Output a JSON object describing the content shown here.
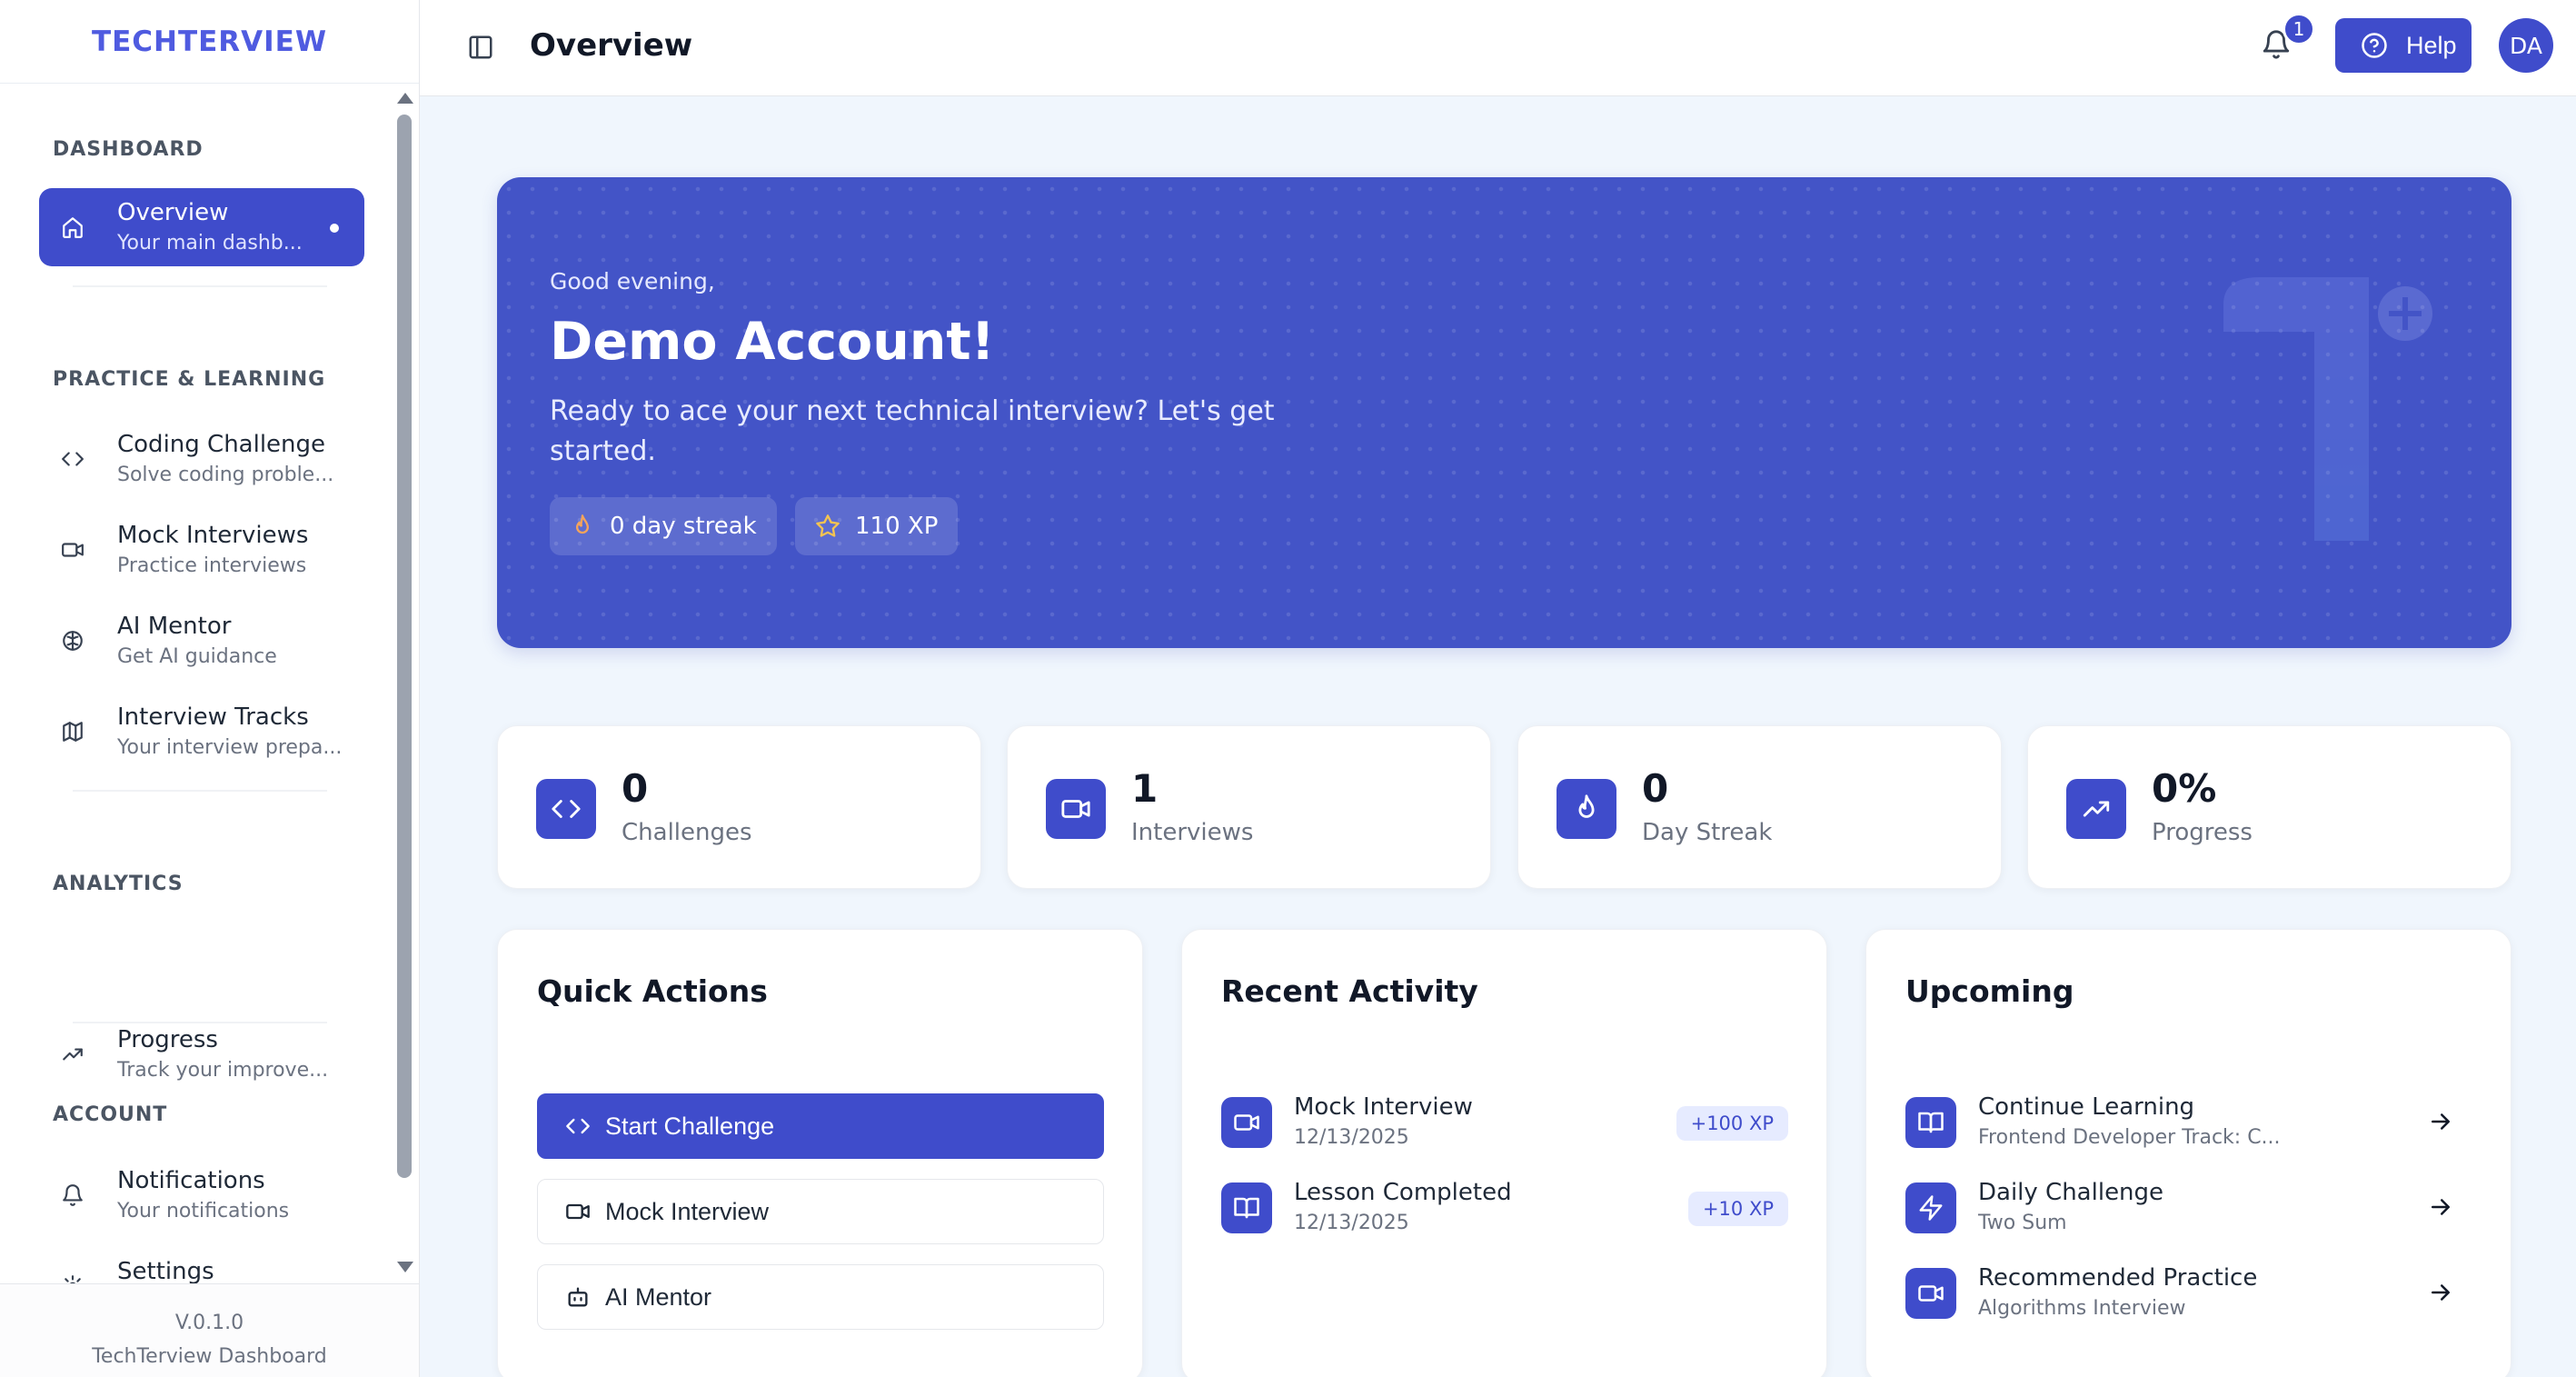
{
  "app": {
    "logo": "TECHTERVIEW",
    "version": "V.0.1.0",
    "footer_name": "TechTerview Dashboard"
  },
  "sidebar": {
    "sections": [
      {
        "label": "DASHBOARD"
      },
      {
        "label": "PRACTICE & LEARNING"
      },
      {
        "label": "ANALYTICS"
      },
      {
        "label": "ACCOUNT"
      }
    ],
    "items": [
      {
        "title": "Overview",
        "subtitle": "Your main dashb...",
        "icon": "home-icon",
        "active": true
      },
      {
        "title": "Coding Challenge",
        "subtitle": "Solve coding proble...",
        "icon": "code-icon"
      },
      {
        "title": "Mock Interviews",
        "subtitle": "Practice interviews",
        "icon": "video-icon"
      },
      {
        "title": "AI Mentor",
        "subtitle": "Get AI guidance",
        "icon": "brain-icon"
      },
      {
        "title": "Interview Tracks",
        "subtitle": "Your interview prepa...",
        "icon": "map-icon"
      },
      {
        "title": "Progress",
        "subtitle": "Track your improve...",
        "icon": "trending-up-icon"
      },
      {
        "title": "Notifications",
        "subtitle": "Your notifications",
        "icon": "bell-icon"
      },
      {
        "title": "Settings",
        "subtitle": "",
        "icon": "gear-icon"
      }
    ]
  },
  "topbar": {
    "title": "Overview",
    "notification_count": "1",
    "help_label": "Help",
    "avatar_initials": "DA"
  },
  "hero": {
    "greeting": "Good evening,",
    "name": "Demo Account!",
    "message": "Ready to ace your next technical interview? Let's get started.",
    "streak_label": "0 day streak",
    "xp_label": "110 XP"
  },
  "stats": [
    {
      "value": "0",
      "label": "Challenges",
      "icon": "code-icon"
    },
    {
      "value": "1",
      "label": "Interviews",
      "icon": "video-icon"
    },
    {
      "value": "0",
      "label": "Day Streak",
      "icon": "flame-icon"
    },
    {
      "value": "0%",
      "label": "Progress",
      "icon": "trending-up-icon"
    }
  ],
  "quick_actions": {
    "title": "Quick Actions",
    "buttons": [
      {
        "label": "Start Challenge",
        "icon": "code-icon"
      },
      {
        "label": "Mock Interview",
        "icon": "video-icon"
      },
      {
        "label": "AI Mentor",
        "icon": "bot-icon"
      }
    ]
  },
  "recent_activity": {
    "title": "Recent Activity",
    "items": [
      {
        "title": "Mock Interview",
        "date": "12/13/2025",
        "xp": "+100 XP",
        "icon": "video-icon"
      },
      {
        "title": "Lesson Completed",
        "date": "12/13/2025",
        "xp": "+10 XP",
        "icon": "book-icon"
      }
    ]
  },
  "upcoming": {
    "title": "Upcoming",
    "items": [
      {
        "title": "Continue Learning",
        "subtitle": "Frontend Developer Track: C...",
        "icon": "book-icon"
      },
      {
        "title": "Daily Challenge",
        "subtitle": "Two Sum",
        "icon": "zap-icon"
      },
      {
        "title": "Recommended Practice",
        "subtitle": "Algorithms Interview",
        "icon": "video-icon"
      }
    ]
  },
  "colors": {
    "accent": "#3f4ccb",
    "hero_bg": "#4354c7",
    "page_bg": "#f0f6fd"
  }
}
